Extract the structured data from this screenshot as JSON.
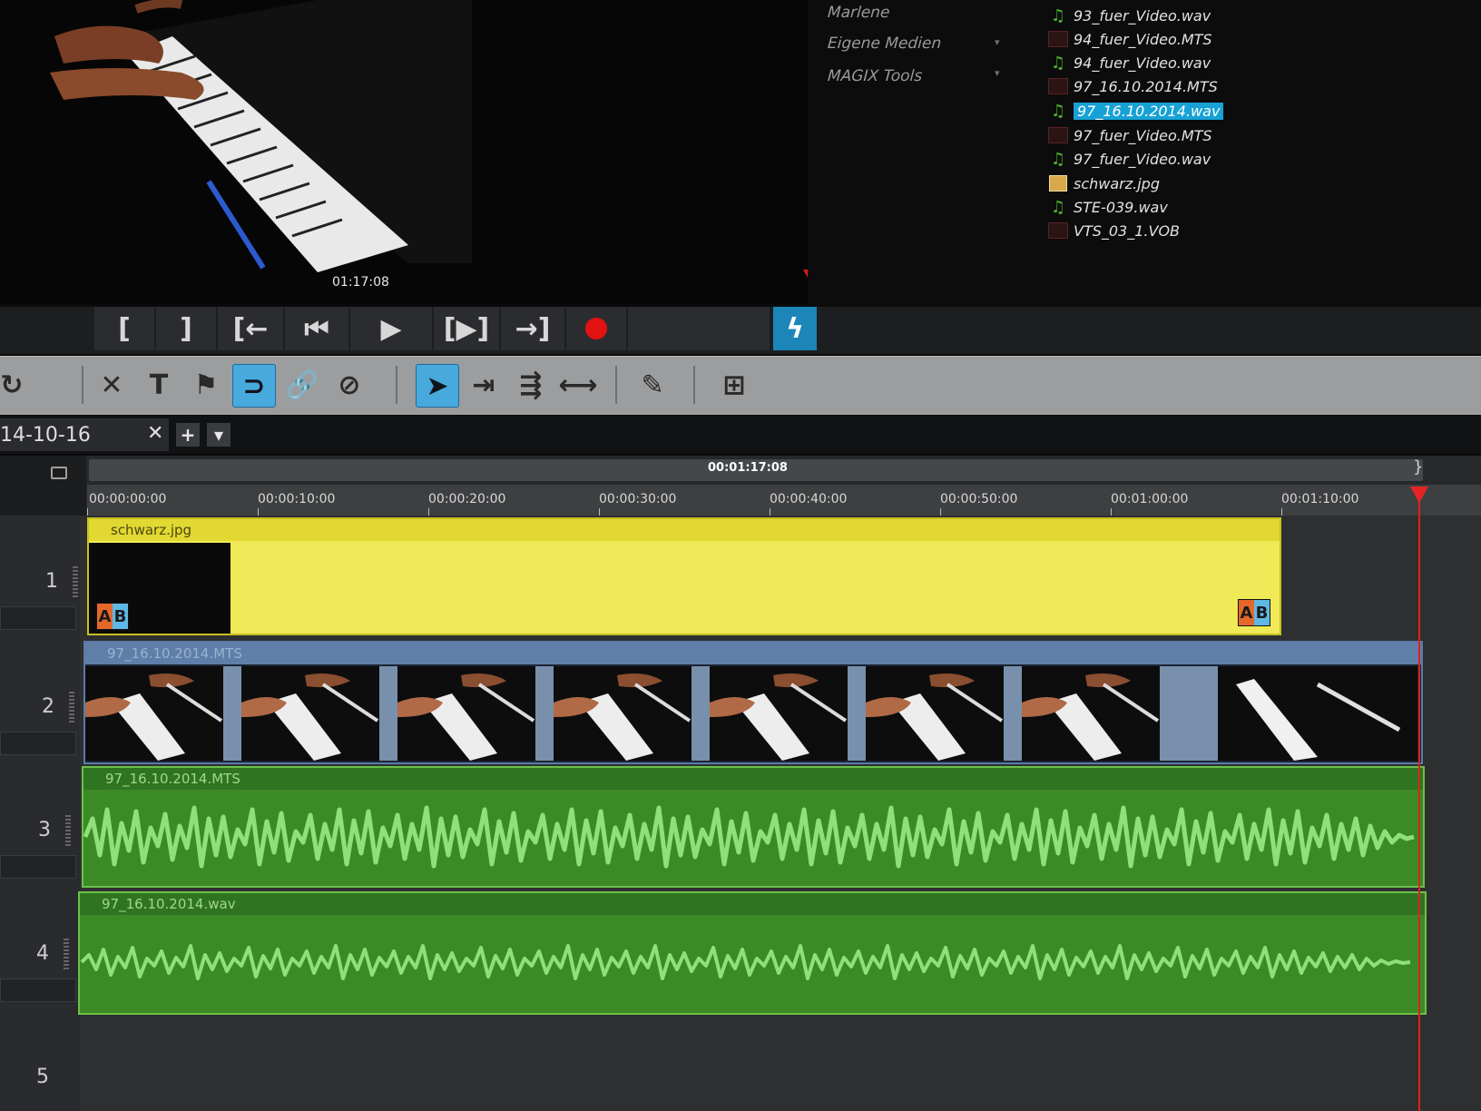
{
  "preview": {
    "timecode": "01:17:08"
  },
  "media_browser": {
    "folders": [
      "Marlene",
      "Eigene Medien",
      "MAGIX Tools"
    ],
    "files": [
      {
        "name": "93_fuer_Video.wav",
        "type": "audio",
        "selected": false
      },
      {
        "name": "94_fuer_Video.MTS",
        "type": "video",
        "selected": false
      },
      {
        "name": "94_fuer_Video.wav",
        "type": "audio",
        "selected": false
      },
      {
        "name": "97_16.10.2014.MTS",
        "type": "video",
        "selected": false
      },
      {
        "name": "97_16.10.2014.wav",
        "type": "audio",
        "selected": true
      },
      {
        "name": "97_fuer_Video.MTS",
        "type": "video",
        "selected": false
      },
      {
        "name": "97_fuer_Video.wav",
        "type": "audio",
        "selected": false
      },
      {
        "name": "schwarz.jpg",
        "type": "image",
        "selected": false
      },
      {
        "name": "STE-039.wav",
        "type": "audio",
        "selected": false
      },
      {
        "name": "VTS_03_1.VOB",
        "type": "video",
        "selected": false
      }
    ]
  },
  "transport": {
    "buttons": [
      {
        "id": "mark-in",
        "glyph": "["
      },
      {
        "id": "mark-out",
        "glyph": "]"
      },
      {
        "id": "go-to-in",
        "glyph": "[←"
      },
      {
        "id": "go-to-start",
        "glyph": "⏮"
      },
      {
        "id": "play",
        "glyph": "▶"
      },
      {
        "id": "play-range",
        "glyph": "[▶]"
      },
      {
        "id": "go-to-out",
        "glyph": "→]"
      }
    ]
  },
  "toolbar": {
    "tools": [
      {
        "id": "redo",
        "glyph": "↻"
      },
      {
        "id": "delete",
        "glyph": "✕"
      },
      {
        "id": "title",
        "glyph": "T"
      },
      {
        "id": "marker",
        "glyph": "⚑"
      },
      {
        "id": "magnet",
        "glyph": "⊃"
      },
      {
        "id": "link",
        "glyph": "🔗"
      },
      {
        "id": "unlink",
        "glyph": "⊘"
      },
      {
        "id": "pointer",
        "glyph": "➤"
      },
      {
        "id": "trim-1",
        "glyph": "⇥"
      },
      {
        "id": "trim-2",
        "glyph": "⇶"
      },
      {
        "id": "stretch",
        "glyph": "⟷"
      },
      {
        "id": "fx",
        "glyph": "✎"
      },
      {
        "id": "zoom-to-fit",
        "glyph": "⊞"
      }
    ]
  },
  "project": {
    "tab_name": "14-10-16",
    "close_glyph": "✕",
    "add_glyph": "+",
    "menu_glyph": "▾"
  },
  "ruler": {
    "range_label": "00:01:17:08",
    "ticks": [
      "00:00:00:00",
      "00:00:10:00",
      "00:00:20:00",
      "00:00:30:00",
      "00:00:40:00",
      "00:00:50:00",
      "00:01:00:00",
      "00:01:10:00"
    ]
  },
  "tracks": [
    {
      "number": "1",
      "clip_name": "schwarz.jpg",
      "kind": "image"
    },
    {
      "number": "2",
      "clip_name": "97_16.10.2014.MTS",
      "kind": "video"
    },
    {
      "number": "3",
      "clip_name": "97_16.10.2014.MTS",
      "kind": "audio"
    },
    {
      "number": "4",
      "clip_name": "97_16.10.2014.wav",
      "kind": "audio"
    },
    {
      "number": "5",
      "clip_name": "",
      "kind": "empty"
    }
  ],
  "colors": {
    "accent": "#17a2d6",
    "playhead": "#e02020",
    "image_clip": "#f0ea58",
    "audio_clip": "#3c8a26",
    "video_clip_header": "#5f7fa8"
  }
}
